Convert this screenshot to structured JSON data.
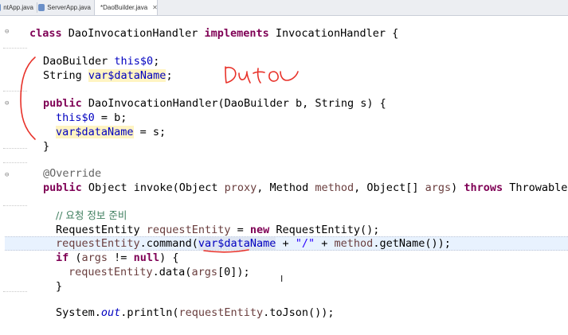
{
  "tabs": [
    {
      "label": "ntApp.java",
      "active": false
    },
    {
      "label": "ServerApp.java",
      "active": false
    },
    {
      "label": "*DaoBuilder.java",
      "active": true,
      "close": "✕"
    }
  ],
  "code": {
    "l1": {
      "kw1": "class",
      "t1": " DaoInvocationHandler ",
      "kw2": "implements",
      "t2": " InvocationHandler {"
    },
    "l2": {
      "t1": "DaoBuilder ",
      "f1": "this$0",
      "t2": ";"
    },
    "l3": {
      "t1": "String ",
      "f1": "var$dataName",
      "t2": ";"
    },
    "l4": {
      "kw1": "public",
      "t1": " DaoInvocationHandler(DaoBuilder b, String s) {"
    },
    "l5": {
      "f1": "this$0",
      "t1": " = b;"
    },
    "l6": {
      "f1": "var$dataName",
      "t1": " = s;"
    },
    "l7": {
      "t1": "}"
    },
    "l8": {
      "ann": "@Override"
    },
    "l9": {
      "kw1": "public",
      "t1": " Object invoke(Object ",
      "v1": "proxy",
      "t2": ", Method ",
      "v2": "method",
      "t3": ", Object[] ",
      "v3": "args",
      "t4": ") ",
      "kw2": "throws",
      "t5": " Throwable {"
    },
    "l10": {
      "cm": "// 요청 정보 준비"
    },
    "l11": {
      "t1": "RequestEntity ",
      "v1": "requestEntity",
      "t2": " = ",
      "kw1": "new",
      "t3": " RequestEntity();"
    },
    "l12": {
      "v1": "requestEntity",
      "t1": ".command(",
      "f1": "var$dataName",
      "t2": " + ",
      "s1": "\"/\"",
      "t3": " + ",
      "v2": "method",
      "t4": ".getName());"
    },
    "l13": {
      "kw1": "if",
      "t1": " (",
      "v1": "args",
      "t2": " != ",
      "kw2": "null",
      "t3": ") {"
    },
    "l14": {
      "v1": "requestEntity",
      "t1": ".data(",
      "v2": "args",
      "t2": "[0]);"
    },
    "l15": {
      "t1": "}"
    },
    "l16": {
      "t1": "System.",
      "i1": "out",
      "t2": ".println(",
      "v1": "requestEntity",
      "t3": ".toJson());"
    }
  },
  "colors": {
    "keyword": "#7f0055",
    "field": "#0000c0",
    "local": "#6a3e3e",
    "comment": "#3f7f5f",
    "string": "#2a00ff",
    "annotation": "#646464",
    "ink": "#e8322a",
    "current_line": "#e8f2fe"
  },
  "overlay": {
    "handwriting": "annotation drawn in red (scribble 'auto')",
    "cursor_icon": "I"
  }
}
